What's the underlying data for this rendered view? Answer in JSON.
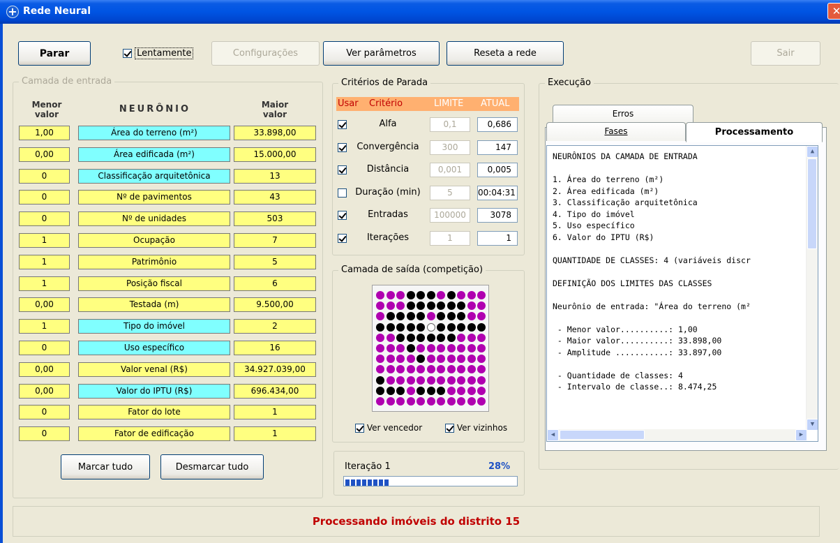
{
  "window": {
    "title": "Rede Neural"
  },
  "toolbar": {
    "stop_label": "Parar",
    "slowly_label": "Lentamente",
    "slowly_checked": true,
    "config_label": "Configurações",
    "params_label": "Ver parâmetros",
    "reset_label": "Reseta a rede",
    "exit_label": "Sair"
  },
  "input_layer": {
    "title": "Camada de entrada",
    "col_min": "Menor\nvalor",
    "col_neuron": "NEURÔNIO",
    "col_max": "Maior\nvalor",
    "rows": [
      {
        "min": "1,00",
        "name": "Área do terreno (m²)",
        "max": "33.898,00",
        "selected": true
      },
      {
        "min": "0,00",
        "name": "Área edificada (m²)",
        "max": "15.000,00",
        "selected": true
      },
      {
        "min": "0",
        "name": "Classificação arquitetônica",
        "max": "13",
        "selected": true
      },
      {
        "min": "0",
        "name": "Nº de pavimentos",
        "max": "43",
        "selected": false
      },
      {
        "min": "0",
        "name": "Nº de unidades",
        "max": "503",
        "selected": false
      },
      {
        "min": "1",
        "name": "Ocupação",
        "max": "7",
        "selected": false
      },
      {
        "min": "1",
        "name": "Patrimônio",
        "max": "5",
        "selected": false
      },
      {
        "min": "1",
        "name": "Posição fiscal",
        "max": "6",
        "selected": false
      },
      {
        "min": "0,00",
        "name": "Testada (m)",
        "max": "9.500,00",
        "selected": false
      },
      {
        "min": "1",
        "name": "Tipo do imóvel",
        "max": "2",
        "selected": true
      },
      {
        "min": "0",
        "name": "Uso específico",
        "max": "16",
        "selected": true
      },
      {
        "min": "0,00",
        "name": "Valor venal (R$)",
        "max": "34.927.039,00",
        "selected": false
      },
      {
        "min": "0,00",
        "name": "Valor do IPTU (R$)",
        "max": "696.434,00",
        "selected": true
      },
      {
        "min": "0",
        "name": "Fator do lote",
        "max": "1",
        "selected": false
      },
      {
        "min": "0",
        "name": "Fator de edificação",
        "max": "1",
        "selected": false
      }
    ],
    "mark_all": "Marcar tudo",
    "unmark_all": "Desmarcar tudo"
  },
  "stop_criteria": {
    "title": "Critérios de Parada",
    "head_use": "Usar",
    "head_criterion": "Critério",
    "head_limit": "LIMITE",
    "head_current": "ATUAL",
    "rows": [
      {
        "label": "Alfa",
        "checked": true,
        "limit": "0,1",
        "current": "0,686"
      },
      {
        "label": "Convergência",
        "checked": true,
        "limit": "300",
        "current": "147"
      },
      {
        "label": "Distância",
        "checked": true,
        "limit": "0,001",
        "current": "0,005"
      },
      {
        "label": "Duração (min)",
        "checked": false,
        "limit": "5",
        "current": "00:04:31"
      },
      {
        "label": "Entradas",
        "checked": true,
        "limit": "100000",
        "current": "3078"
      },
      {
        "label": "Iterações",
        "checked": true,
        "limit": "1",
        "current": "1"
      }
    ]
  },
  "output_layer": {
    "title": "Camada de saída (competição)",
    "colors": {
      "magenta": "#B000B0",
      "black": "#000000",
      "winner": "#FFFFFF"
    },
    "grid": [
      "MMMKKKMKMMM",
      "MMMKKKKKKMM",
      "MKKKKMKKKMM",
      "KKKKKWKKKKK",
      "MMKKKKKKMMM",
      "MMMKMMMMMMM",
      "MMMMKMMMMMM",
      "MMMMMMMMMMM",
      "KMMMMMMMMMM",
      "KKKMKKKMMMM",
      "MMMMMMMMMMM"
    ],
    "show_winner_label": "Ver vencedor",
    "show_neighbors_label": "Ver vizinhos"
  },
  "progress": {
    "label": "Iteração 1",
    "percent_text": "28%",
    "fraction": 0.28,
    "color": "#1F52C4"
  },
  "execution": {
    "title": "Execução",
    "tabs": {
      "errors": "Erros",
      "phases": "Fases",
      "processing": "Processamento"
    },
    "lines": [
      "NEURÔNIOS DA CAMADA DE ENTRADA",
      "",
      "1. Área do terreno (m²)",
      "2. Área edificada (m²)",
      "3. Classificação arquitetônica",
      "4. Tipo do imóvel",
      "5. Uso específico",
      "6. Valor do IPTU (R$)",
      "",
      "QUANTIDADE DE CLASSES: 4 (variáveis discr",
      "",
      "DEFINIÇÃO DOS LIMITES DAS CLASSES",
      "",
      "Neurônio de entrada: \"Área do terreno (m²",
      "",
      " - Menor valor..........: 1,00",
      " - Maior valor..........: 33.898,00",
      " - Amplitude ...........: 33.897,00",
      "",
      " - Quantidade de classes: 4",
      " - Intervalo de classe..: 8.474,25"
    ]
  },
  "status": {
    "message": "Processando imóveis do distrito 15"
  }
}
